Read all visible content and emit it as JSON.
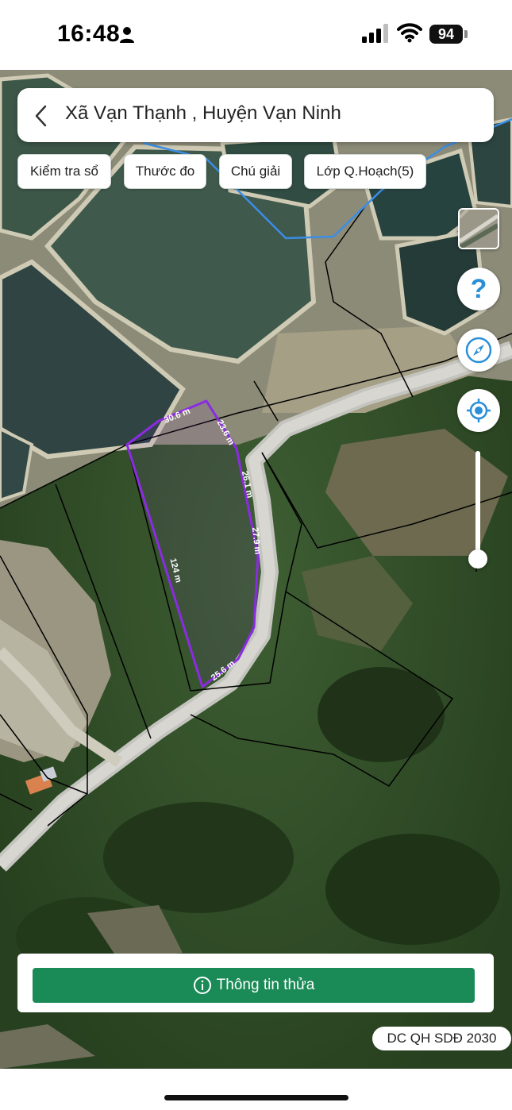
{
  "status_bar": {
    "time": "16:48",
    "battery_level": "94",
    "icons": [
      "person-icon",
      "signal-icon",
      "wifi-icon",
      "battery-icon"
    ]
  },
  "header": {
    "back_icon": "chevron-left-icon",
    "location": "Xã Vạn Thạnh , Huyện Vạn Ninh"
  },
  "toolbar": {
    "check_book": "Kiểm tra sổ",
    "ruler": "Thước đo",
    "legend": "Chú giải",
    "planning_layer": "Lớp Q.Hoạch(5)"
  },
  "map_controls": {
    "icons": [
      "layer-thumbnail",
      "help-icon",
      "compass-icon",
      "locate-icon",
      "zoom-slider"
    ],
    "help_label": "?"
  },
  "parcel": {
    "outline_color": "#8b2be2",
    "edge_labels": [
      "30.6 m",
      "23.6 m",
      "26.1 m",
      "27.9 m",
      "25.6 m",
      "124 m"
    ]
  },
  "info_panel": {
    "button_label": "Thông tin thửa",
    "button_color": "#1a8a57"
  },
  "badge": {
    "label": "DC QH SDĐ 2030"
  }
}
